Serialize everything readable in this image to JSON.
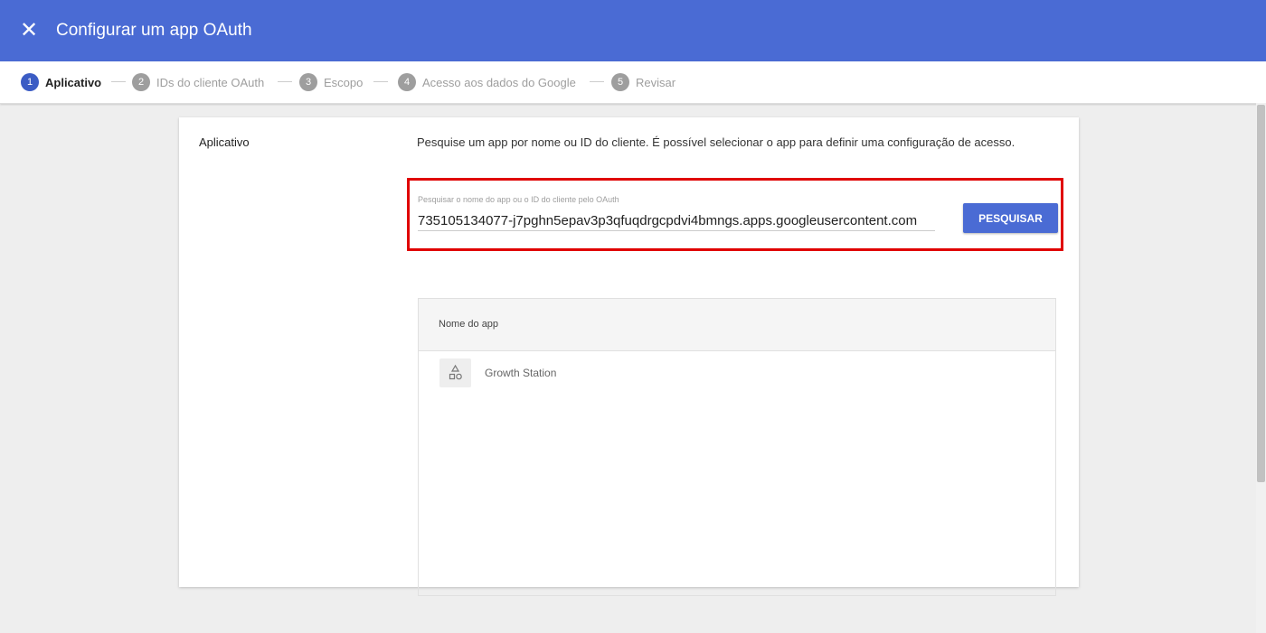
{
  "header": {
    "title": "Configurar um app OAuth",
    "close_icon": "close-icon",
    "accent_color": "#4a6bd4"
  },
  "stepper": {
    "steps": [
      {
        "number": "1",
        "label": "Aplicativo",
        "active": true
      },
      {
        "number": "2",
        "label": "IDs do cliente OAuth",
        "active": false
      },
      {
        "number": "3",
        "label": "Escopo",
        "active": false
      },
      {
        "number": "4",
        "label": "Acesso aos dados do Google",
        "active": false
      },
      {
        "number": "5",
        "label": "Revisar",
        "active": false
      }
    ]
  },
  "app_section": {
    "label": "Aplicativo",
    "description": "Pesquise um app por nome ou ID do cliente. É possível selecionar o app para definir uma configuração de acesso.",
    "search": {
      "field_label": "Pesquisar o nome do app ou o ID do cliente pelo OAuth",
      "value": "735105134077-j7pghn5epav3p3qfuqdrgcpdvi4bmngs.apps.googleusercontent.com",
      "button_label": "PESQUISAR",
      "highlight_color": "#e00000"
    },
    "table": {
      "column_header": "Nome do app",
      "rows": [
        {
          "name": "Growth Station",
          "icon": "shapes-icon"
        }
      ]
    }
  }
}
